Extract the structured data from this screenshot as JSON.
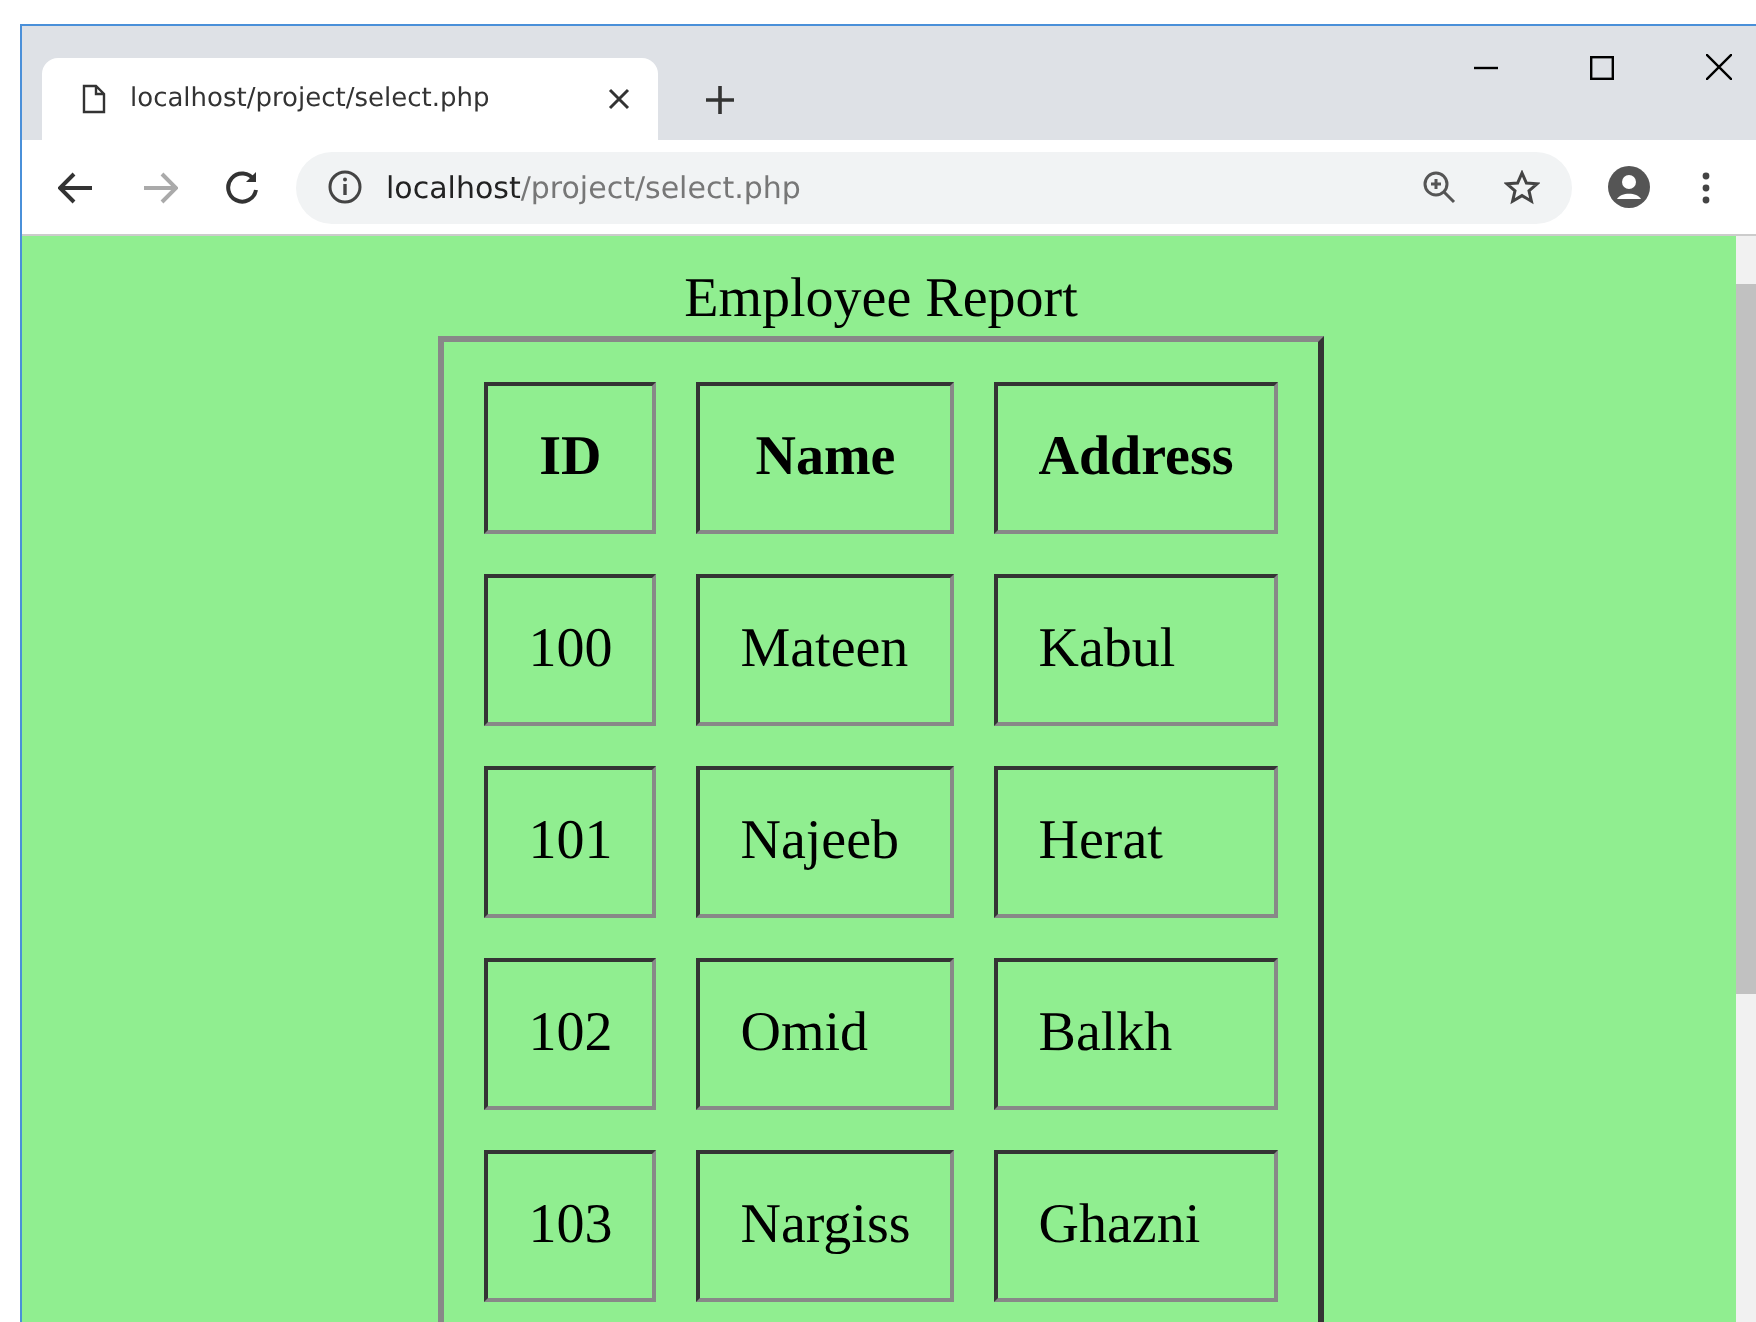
{
  "browser": {
    "tab": {
      "title": "localhost/project/select.php",
      "selected": true
    },
    "address": {
      "host": "localhost",
      "path": "/project/select.php"
    }
  },
  "table": {
    "caption": "Employee Report",
    "columns": [
      "ID",
      "Name",
      "Address"
    ],
    "rows": [
      [
        "100",
        "Mateen",
        "Kabul"
      ],
      [
        "101",
        "Najeeb",
        "Herat"
      ],
      [
        "102",
        "Omid",
        "Balkh"
      ],
      [
        "103",
        "Nargiss",
        "Ghazni"
      ]
    ]
  }
}
